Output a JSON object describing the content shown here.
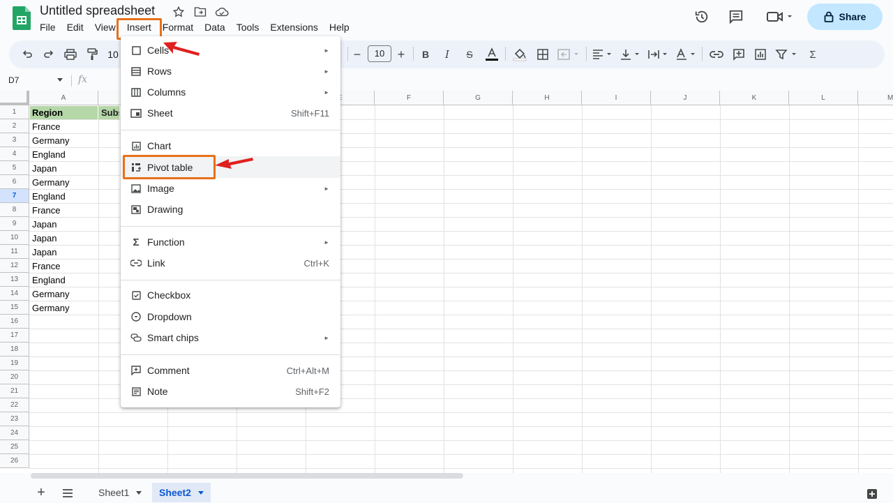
{
  "header": {
    "title": "Untitled spreadsheet",
    "menu": [
      "File",
      "Edit",
      "View",
      "Insert",
      "Format",
      "Data",
      "Tools",
      "Extensions",
      "Help"
    ],
    "active_menu": "Insert",
    "share_label": "Share"
  },
  "toolbar": {
    "zoom_partial": "10",
    "font_size": "10"
  },
  "formula_bar": {
    "name_box": "D7",
    "fx": "fx"
  },
  "grid": {
    "columns": [
      "A",
      "",
      "",
      "",
      "E",
      "F",
      "G",
      "H",
      "I",
      "J",
      "K",
      "L",
      "M"
    ],
    "rows": [
      "1",
      "2",
      "3",
      "4",
      "5",
      "6",
      "7",
      "8",
      "9",
      "10",
      "11",
      "12",
      "13",
      "14",
      "15",
      "16",
      "17",
      "18",
      "19",
      "20",
      "21",
      "22",
      "23",
      "24",
      "25",
      "26"
    ],
    "selected_row": "7",
    "header_a": "Region",
    "header_b_partial": "Subs",
    "column_a": [
      "France",
      "Germany",
      "England",
      "Japan",
      "Germany",
      "England",
      "France",
      "Japan",
      "Japan",
      "Japan",
      "France",
      "England",
      "Germany",
      "Germany"
    ]
  },
  "insert_menu": {
    "items": [
      {
        "label": "Cells",
        "icon": "cells-icon",
        "shortcut": "",
        "submenu": true
      },
      {
        "label": "Rows",
        "icon": "rows-icon",
        "shortcut": "",
        "submenu": true
      },
      {
        "label": "Columns",
        "icon": "columns-icon",
        "shortcut": "",
        "submenu": true
      },
      {
        "label": "Sheet",
        "icon": "sheet-icon",
        "shortcut": "Shift+F11",
        "submenu": false
      },
      {
        "label": "Chart",
        "icon": "chart-icon",
        "shortcut": "",
        "submenu": false
      },
      {
        "label": "Pivot table",
        "icon": "pivot-table-icon",
        "shortcut": "",
        "submenu": false
      },
      {
        "label": "Image",
        "icon": "image-icon",
        "shortcut": "",
        "submenu": true
      },
      {
        "label": "Drawing",
        "icon": "drawing-icon",
        "shortcut": "",
        "submenu": false
      },
      {
        "label": "Function",
        "icon": "function-icon",
        "shortcut": "",
        "submenu": true
      },
      {
        "label": "Link",
        "icon": "link-icon",
        "shortcut": "Ctrl+K",
        "submenu": false
      },
      {
        "label": "Checkbox",
        "icon": "checkbox-icon",
        "shortcut": "",
        "submenu": false
      },
      {
        "label": "Dropdown",
        "icon": "dropdown-icon",
        "shortcut": "",
        "submenu": false
      },
      {
        "label": "Smart chips",
        "icon": "smart-chips-icon",
        "shortcut": "",
        "submenu": true
      },
      {
        "label": "Comment",
        "icon": "comment-icon",
        "shortcut": "Ctrl+Alt+M",
        "submenu": false
      },
      {
        "label": "Note",
        "icon": "note-icon",
        "shortcut": "Shift+F2",
        "submenu": false
      }
    ],
    "highlighted": "Pivot table"
  },
  "sheets": {
    "tabs": [
      "Sheet1",
      "Sheet2"
    ],
    "active": "Sheet2"
  },
  "colors": {
    "accent": "#0b57d0",
    "highlight_box": "#e8701a",
    "arrow": "#e02020",
    "header_fill": "#b6d7a8",
    "share_bg": "#c2e7ff"
  }
}
